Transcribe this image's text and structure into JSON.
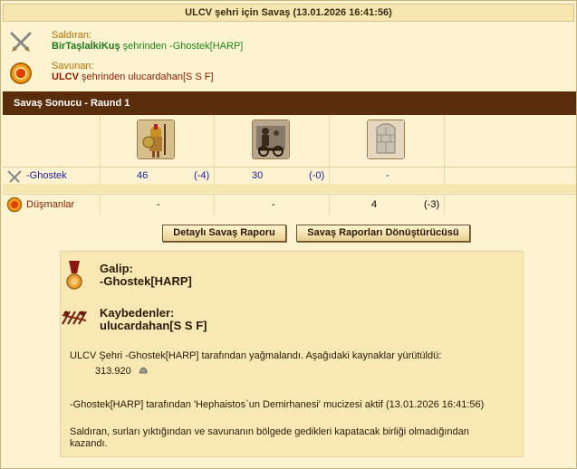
{
  "title": "ULCV şehri için Savaş (13.01.2026 16:41:56)",
  "attacker": {
    "label": "Saldıran:",
    "village": "BirTaşlaİkiKuş",
    "mid": " şehrinden ",
    "player": "-Ghostek[HARP]"
  },
  "defender": {
    "label": "Savunan:",
    "village": "ULCV",
    "mid": " şehrinden ",
    "player": "ulucardahan[S S F]"
  },
  "result_header": "Savaş Sonucu - Raund 1",
  "units": [
    {
      "icon": "spartan-warrior-icon"
    },
    {
      "icon": "chariot-icon"
    },
    {
      "icon": "wall-icon"
    }
  ],
  "rows": [
    {
      "name": "-Ghostek",
      "icon": "crossed-swords-icon",
      "cells": [
        {
          "value": "46",
          "loss": "(-4)"
        },
        {
          "value": "30",
          "loss": "(-0)"
        },
        {
          "value": "-",
          "loss": ""
        }
      ]
    },
    {
      "name": "Düşmanlar",
      "icon": "shield-icon",
      "cells": [
        {
          "value": "-",
          "loss": ""
        },
        {
          "value": "-",
          "loss": ""
        },
        {
          "value": "4",
          "loss": "(-3)"
        }
      ]
    }
  ],
  "buttons": {
    "detail": "Detaylı Savaş Raporu",
    "converter": "Savaş Raporları Dönüştürücüsü"
  },
  "winner": {
    "label": "Galip:",
    "name": "-Ghostek[HARP]"
  },
  "losers": {
    "label": "Kaybedenler:",
    "name": "ulucardahan[S S F]"
  },
  "plunder_text": "ULCV Şehri -Ghostek[HARP] tarafından yağmalandı. Aşağıdaki kaynaklar yürütüldü:",
  "plunder_amount": "313.920",
  "wonder_text": "-Ghostek[HARP] tarafından 'Hephaistos`un Demirhanesi' mucizesi aktif (13.01.2026 16:41:56)",
  "final_text_1": "Saldıran, surları yıktığından ve savunanın bölgede gedikleri kapatacak birliği olmadığından",
  "final_text_2": "kazandı.",
  "colors": {
    "header_bg": "#5a2d0c",
    "page_bg": "#fdf3d0",
    "link_blue": "#1a1aa0",
    "winner_green": "#1a8a1a",
    "loser_red": "#8a1a00"
  }
}
